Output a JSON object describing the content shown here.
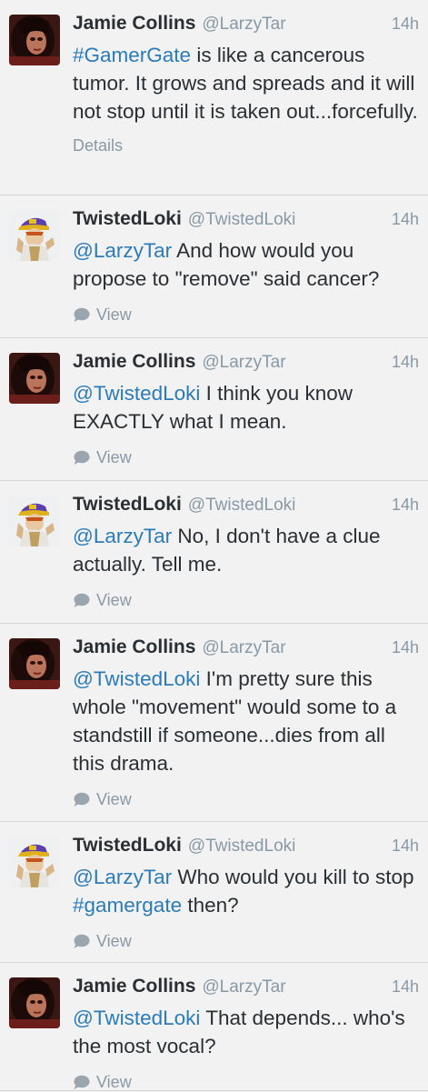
{
  "tweets": [
    {
      "name": "Jamie Collins",
      "handle": "@LarzyTar",
      "time": "14h",
      "avatar": "jamie-avatar",
      "segments": [
        {
          "t": "#GamerGate",
          "link": true
        },
        {
          "t": " is like a cancerous tumor. It grows and spreads and it will not stop until it is taken out...forcefully.",
          "link": false
        }
      ],
      "action": "Details",
      "action_type": "details"
    },
    {
      "name": "TwistedLoki",
      "handle": "@TwistedLoki",
      "time": "14h",
      "avatar": "loki-avatar",
      "segments": [
        {
          "t": "@LarzyTar",
          "link": true
        },
        {
          "t": " And how would you propose to \"remove\" said cancer?",
          "link": false
        }
      ],
      "action": "View",
      "action_type": "view"
    },
    {
      "name": "Jamie Collins",
      "handle": "@LarzyTar",
      "time": "14h",
      "avatar": "jamie-avatar",
      "segments": [
        {
          "t": "@TwistedLoki",
          "link": true
        },
        {
          "t": " I think you know EXACTLY what I mean.",
          "link": false
        }
      ],
      "action": "View",
      "action_type": "view"
    },
    {
      "name": "TwistedLoki",
      "handle": "@TwistedLoki",
      "time": "14h",
      "avatar": "loki-avatar",
      "segments": [
        {
          "t": "@LarzyTar",
          "link": true
        },
        {
          "t": " No, I don't have a clue actually. Tell me.",
          "link": false
        }
      ],
      "action": "View",
      "action_type": "view"
    },
    {
      "name": "Jamie Collins",
      "handle": "@LarzyTar",
      "time": "14h",
      "avatar": "jamie-avatar",
      "segments": [
        {
          "t": "@TwistedLoki",
          "link": true
        },
        {
          "t": "  I'm pretty sure this whole \"movement\" would some to a standstill if someone...dies from all this drama.",
          "link": false
        }
      ],
      "action": "View",
      "action_type": "view"
    },
    {
      "name": "TwistedLoki",
      "handle": "@TwistedLoki",
      "time": "14h",
      "avatar": "loki-avatar",
      "segments": [
        {
          "t": "@LarzyTar",
          "link": true
        },
        {
          "t": " Who would you kill to stop ",
          "link": false
        },
        {
          "t": "#gamergate",
          "link": true
        },
        {
          "t": " then?",
          "link": false
        }
      ],
      "action": "View",
      "action_type": "view"
    },
    {
      "name": "Jamie Collins",
      "handle": "@LarzyTar",
      "time": "14h",
      "avatar": "jamie-avatar",
      "segments": [
        {
          "t": "@TwistedLoki",
          "link": true
        },
        {
          "t": " That depends... who's the most vocal?",
          "link": false
        }
      ],
      "action": "View",
      "action_type": "view"
    }
  ],
  "colors": {
    "background": "#f2f2f2",
    "link": "#2b7bb9",
    "muted": "#8899a6",
    "text": "#292f33"
  }
}
